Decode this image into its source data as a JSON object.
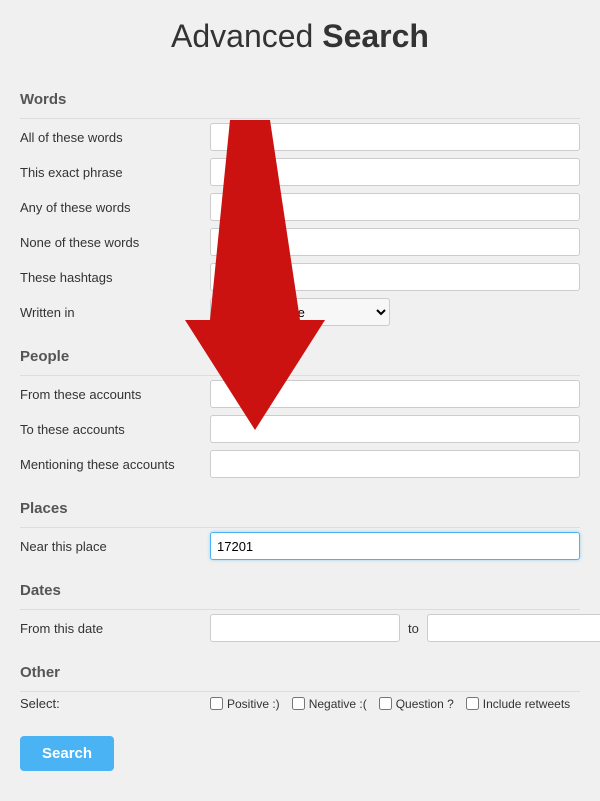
{
  "header": {
    "title_normal": "Advanced ",
    "title_bold": "Search"
  },
  "sections": {
    "words": {
      "label": "Words",
      "fields": [
        {
          "id": "all_words",
          "label": "All of these words",
          "value": "",
          "placeholder": ""
        },
        {
          "id": "exact_phrase",
          "label": "This exact phrase",
          "value": "",
          "placeholder": ""
        },
        {
          "id": "any_words",
          "label": "Any of these words",
          "value": "",
          "placeholder": ""
        },
        {
          "id": "none_words",
          "label": "None of these words",
          "value": "",
          "placeholder": ""
        },
        {
          "id": "hashtags",
          "label": "These hashtags",
          "value": "",
          "placeholder": ""
        }
      ],
      "written_in": {
        "label": "Written in",
        "default_option": "Any Language"
      }
    },
    "people": {
      "label": "People",
      "fields": [
        {
          "id": "from_accounts",
          "label": "From these accounts",
          "value": "",
          "placeholder": ""
        },
        {
          "id": "to_accounts",
          "label": "To these accounts",
          "value": "",
          "placeholder": ""
        },
        {
          "id": "mentioning_accounts",
          "label": "Mentioning these accounts",
          "value": "",
          "placeholder": ""
        }
      ]
    },
    "places": {
      "label": "Places",
      "fields": [
        {
          "id": "near_place",
          "label": "Near this place",
          "value": "17201",
          "placeholder": "",
          "highlighted": true
        }
      ]
    },
    "dates": {
      "label": "Dates",
      "from_label": "From this date",
      "from_value": "",
      "to_label": "to",
      "to_value": ""
    },
    "other": {
      "label": "Other",
      "select_label": "Select:",
      "checkboxes": [
        {
          "id": "positive",
          "label": "Positive :)",
          "checked": false
        },
        {
          "id": "negative",
          "label": "Negative :(",
          "checked": false
        },
        {
          "id": "question",
          "label": "Question ?",
          "checked": false
        },
        {
          "id": "include_retweets",
          "label": "Include retweets",
          "checked": false
        }
      ]
    }
  },
  "search_button": {
    "label": "Search"
  }
}
